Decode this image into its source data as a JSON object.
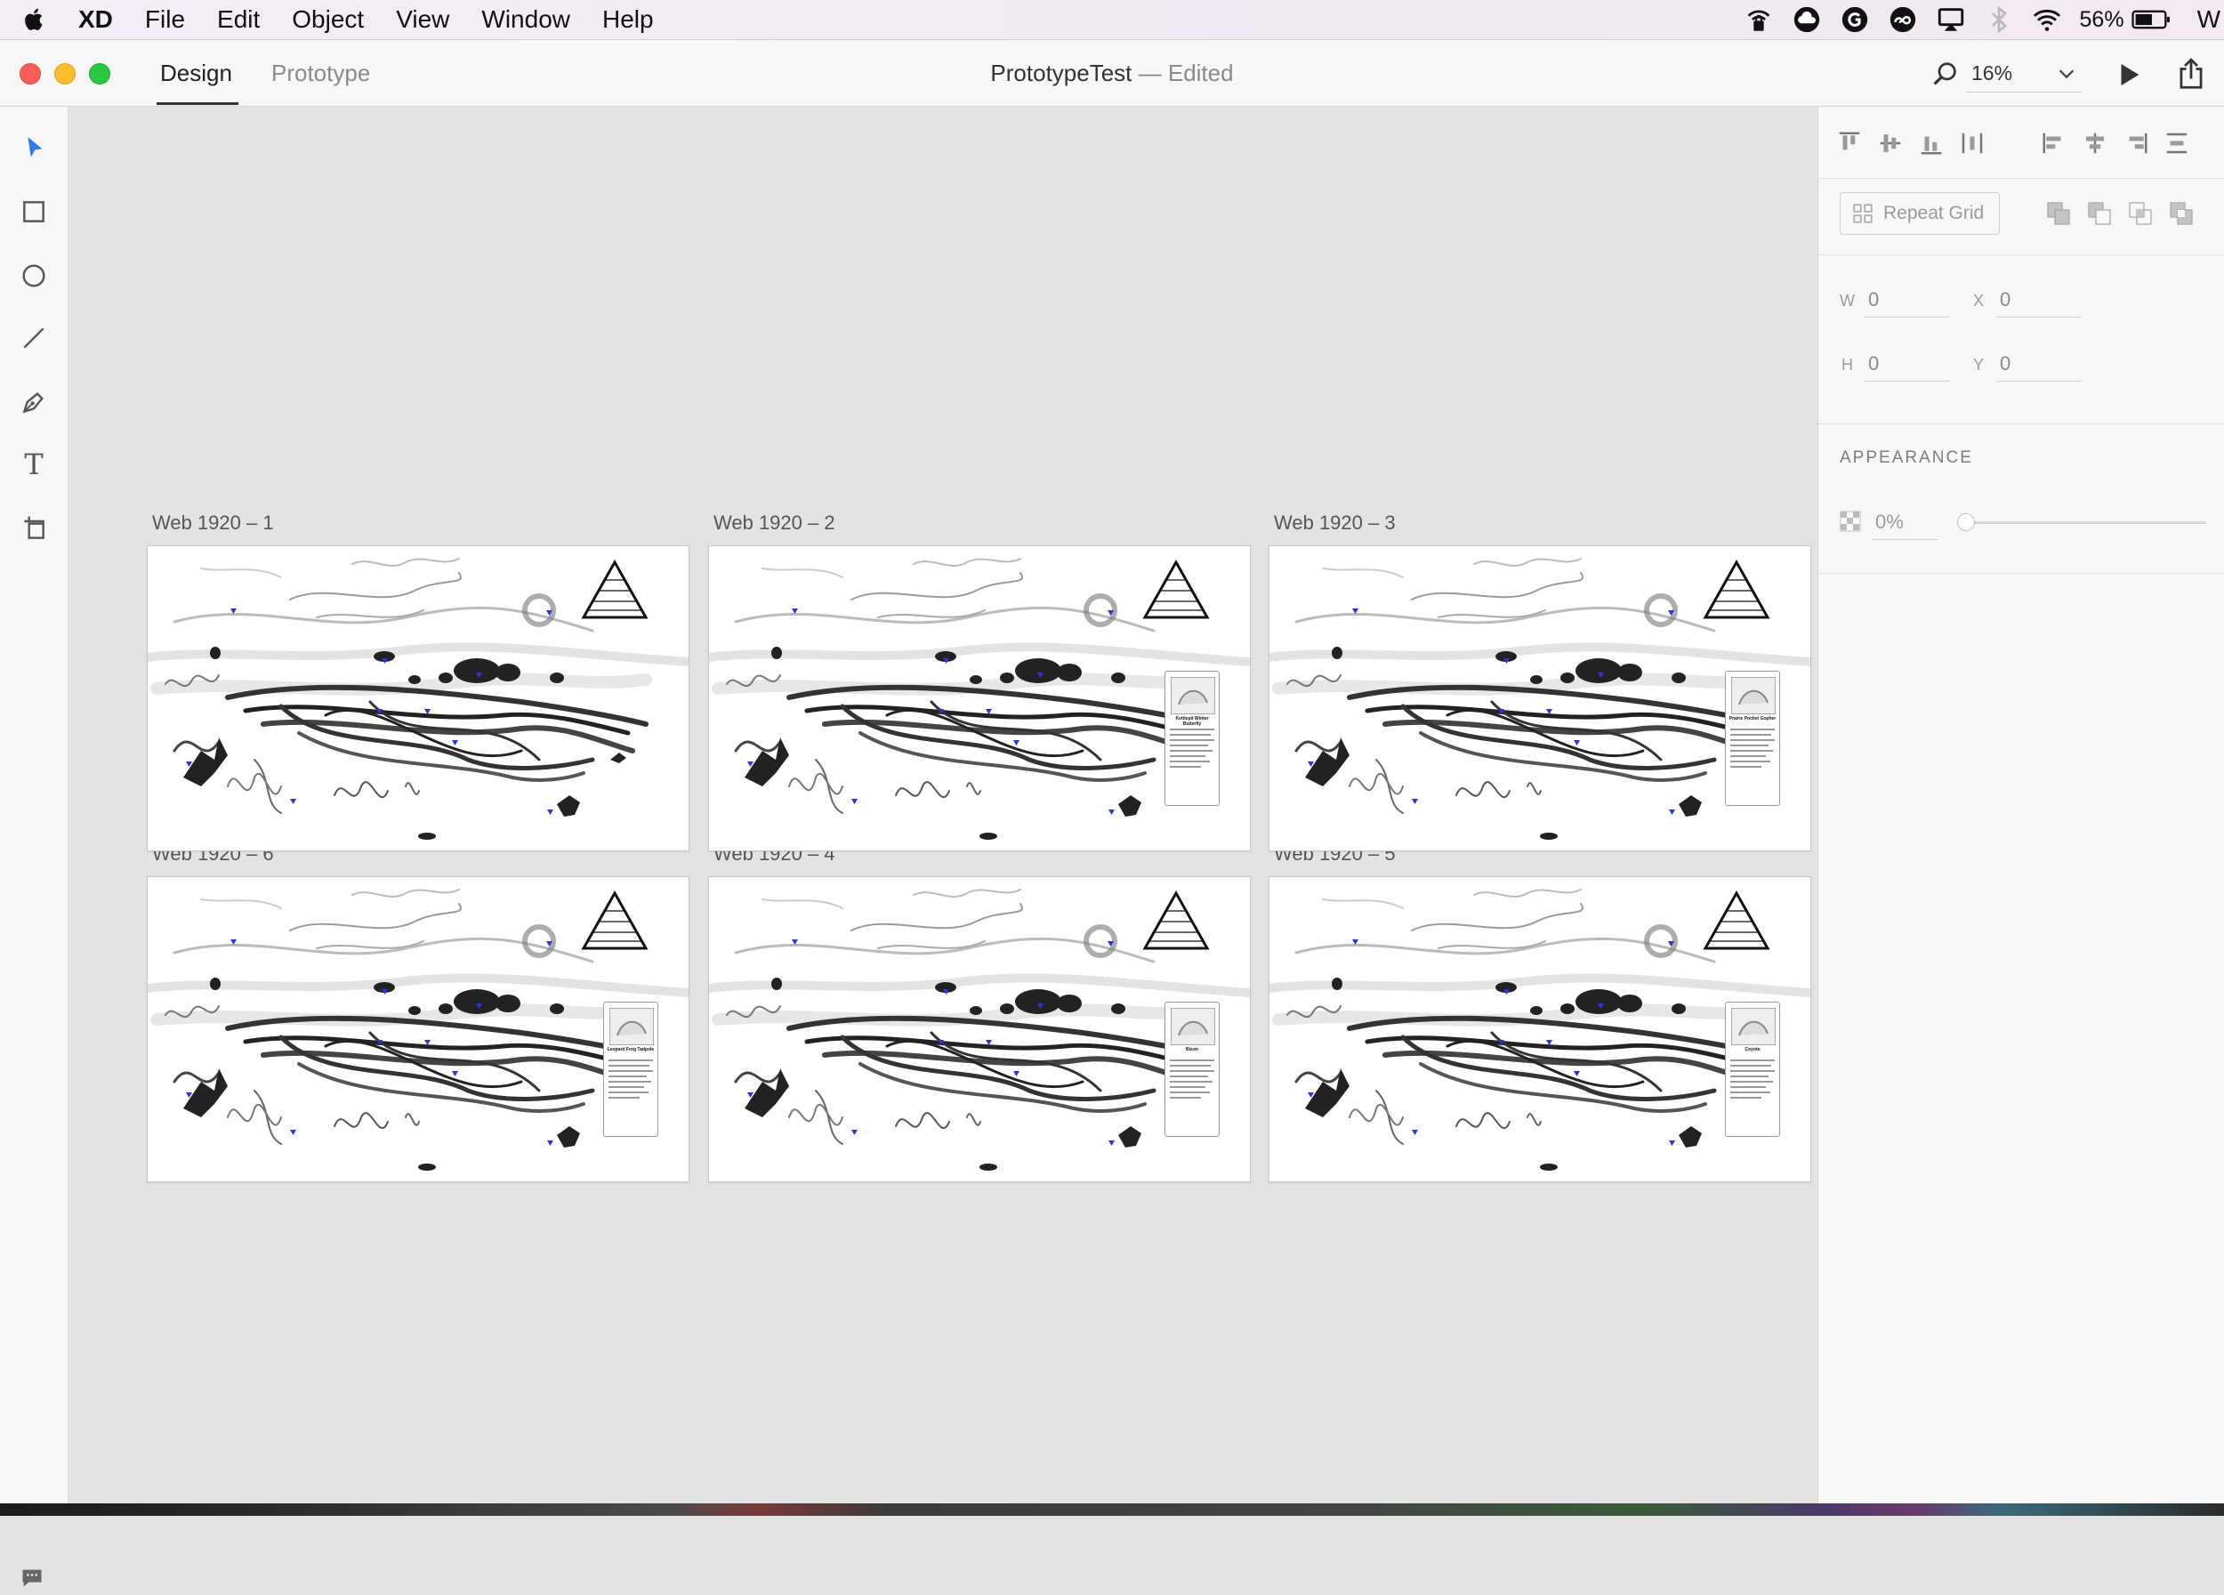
{
  "menubar": {
    "app_name": "XD",
    "items": [
      "File",
      "Edit",
      "Object",
      "View",
      "Window",
      "Help"
    ],
    "battery": "56%",
    "clock_initial": "W",
    "status_icons": [
      "lock-wifi-icon",
      "cloud-icon",
      "grammarly-icon",
      "creative-cloud-icon",
      "airplay-icon",
      "bluetooth-icon",
      "wifi-icon",
      "battery-icon"
    ]
  },
  "titlebar": {
    "tabs": {
      "design": "Design",
      "prototype": "Prototype"
    },
    "doc_name": "PrototypeTest",
    "doc_state": " — Edited",
    "zoom": "16%"
  },
  "toolbar": {
    "tools": [
      "select-tool",
      "rectangle-tool",
      "ellipse-tool",
      "line-tool",
      "pen-tool",
      "text-tool",
      "artboard-tool"
    ],
    "text_tool_glyph": "T"
  },
  "canvas": {
    "artboards": [
      {
        "label": "Web 1920 – 1",
        "card": null
      },
      {
        "label": "Web 1920 – 2",
        "card": "Kettlepit Winter Butterfly"
      },
      {
        "label": "Web 1920 – 3",
        "card": "Prairie Pocket Gopher"
      },
      {
        "label": "Web 1920 – 6",
        "card": "Leopard Frog Tadpole"
      },
      {
        "label": "Web 1920 – 4",
        "card": "Bison"
      },
      {
        "label": "Web 1920 – 5",
        "card": "Coyote"
      }
    ]
  },
  "inspector": {
    "repeat_grid": "Repeat Grid",
    "w_label": "W",
    "w_value": "0",
    "x_label": "X",
    "x_value": "0",
    "h_label": "H",
    "h_value": "0",
    "y_label": "Y",
    "y_value": "0",
    "appearance": "APPEARANCE",
    "opacity": "0%",
    "opacity_level": 0
  },
  "colors": {
    "accent": "#2d7cf6",
    "close": "#fc5f57",
    "minimize": "#fdbc2e",
    "zoom": "#28c840",
    "marker_blue": "#2a36d8"
  }
}
